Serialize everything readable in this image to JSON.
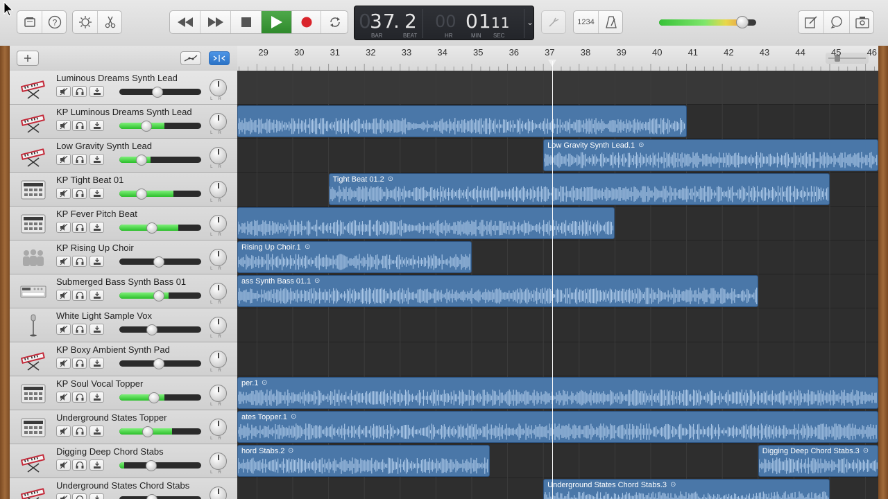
{
  "transport": {
    "bar": "37",
    "beat": "2",
    "bar_label": "BAR",
    "beat_label": "BEAT",
    "hr_label": "HR",
    "min_label": "MIN",
    "sec_label": "SEC",
    "hours_ghost": "00",
    "minutes": "01",
    "seconds": "11",
    "count_in_label": "1234"
  },
  "master_volume": 0.86,
  "ruler": {
    "bars": [
      "29",
      "30",
      "31",
      "32",
      "33",
      "34",
      "35",
      "36",
      "37",
      "38",
      "39",
      "40",
      "41",
      "42",
      "43",
      "44",
      "45",
      "46"
    ]
  },
  "tracks": [
    {
      "name": "Luminous Dreams Synth Lead",
      "icon": "synth-keyboard-icon",
      "level": 0.47,
      "meter": 0.0,
      "selected": true
    },
    {
      "name": "KP Luminous Dreams Synth Lead",
      "icon": "synth-keyboard-icon",
      "level": 0.33,
      "meter": 0.55
    },
    {
      "name": "Low Gravity Synth Lead",
      "icon": "synth-keyboard-icon",
      "level": 0.27,
      "meter": 0.38
    },
    {
      "name": "KP Tight Beat 01",
      "icon": "drum-machine-icon",
      "level": 0.27,
      "meter": 0.66
    },
    {
      "name": "KP Fever Pitch Beat",
      "icon": "drum-machine-icon",
      "level": 0.4,
      "meter": 0.72
    },
    {
      "name": "KP Rising Up Choir",
      "icon": "choir-icon",
      "level": 0.48,
      "meter": 0.0
    },
    {
      "name": "Submerged Bass Synth Bass 01",
      "icon": "bass-synth-icon",
      "level": 0.48,
      "meter": 0.6
    },
    {
      "name": "White Light Sample Vox",
      "icon": "microphone-icon",
      "level": 0.4,
      "meter": 0.0
    },
    {
      "name": "KP Boxy Ambient Synth Pad",
      "icon": "synth-keyboard-icon",
      "level": 0.48,
      "meter": 0.0
    },
    {
      "name": "KP Soul Vocal Topper",
      "icon": "drum-machine-icon",
      "level": 0.42,
      "meter": 0.55
    },
    {
      "name": "Underground States Topper",
      "icon": "drum-machine-icon",
      "level": 0.35,
      "meter": 0.64
    },
    {
      "name": "Digging Deep Chord Stabs",
      "icon": "synth-keyboard-icon",
      "level": 0.39,
      "meter": 0.06
    },
    {
      "name": "Underground States Chord Stabs",
      "icon": "synth-keyboard-icon",
      "level": 0.4,
      "meter": 0.0
    }
  ],
  "regions": [
    {
      "lane": 1,
      "start": 28.0,
      "end": 41.0,
      "label": ""
    },
    {
      "lane": 2,
      "start": 37.0,
      "end": 47.0,
      "label": "Low Gravity Synth Lead.1"
    },
    {
      "lane": 3,
      "start": 31.0,
      "end": 45.0,
      "label": "Tight Beat 01.2"
    },
    {
      "lane": 4,
      "start": 28.0,
      "end": 39.0,
      "label": ""
    },
    {
      "lane": 5,
      "start": 28.0,
      "end": 35.0,
      "label": "Rising Up Choir.1"
    },
    {
      "lane": 6,
      "start": 28.0,
      "end": 43.0,
      "label": "ass Synth Bass 01.1"
    },
    {
      "lane": 9,
      "start": 28.0,
      "end": 47.0,
      "label": "per.1"
    },
    {
      "lane": 10,
      "start": 28.0,
      "end": 47.0,
      "label": "ates Topper.1"
    },
    {
      "lane": 11,
      "start": 28.0,
      "end": 35.5,
      "label": "hord Stabs.2"
    },
    {
      "lane": 11,
      "start": 43.0,
      "end": 47.0,
      "label": "Digging Deep Chord Stabs.3"
    },
    {
      "lane": 12,
      "start": 37.0,
      "end": 45.0,
      "label": "Underground States Chord Stabs.3"
    }
  ],
  "playhead_bar": 37.25
}
